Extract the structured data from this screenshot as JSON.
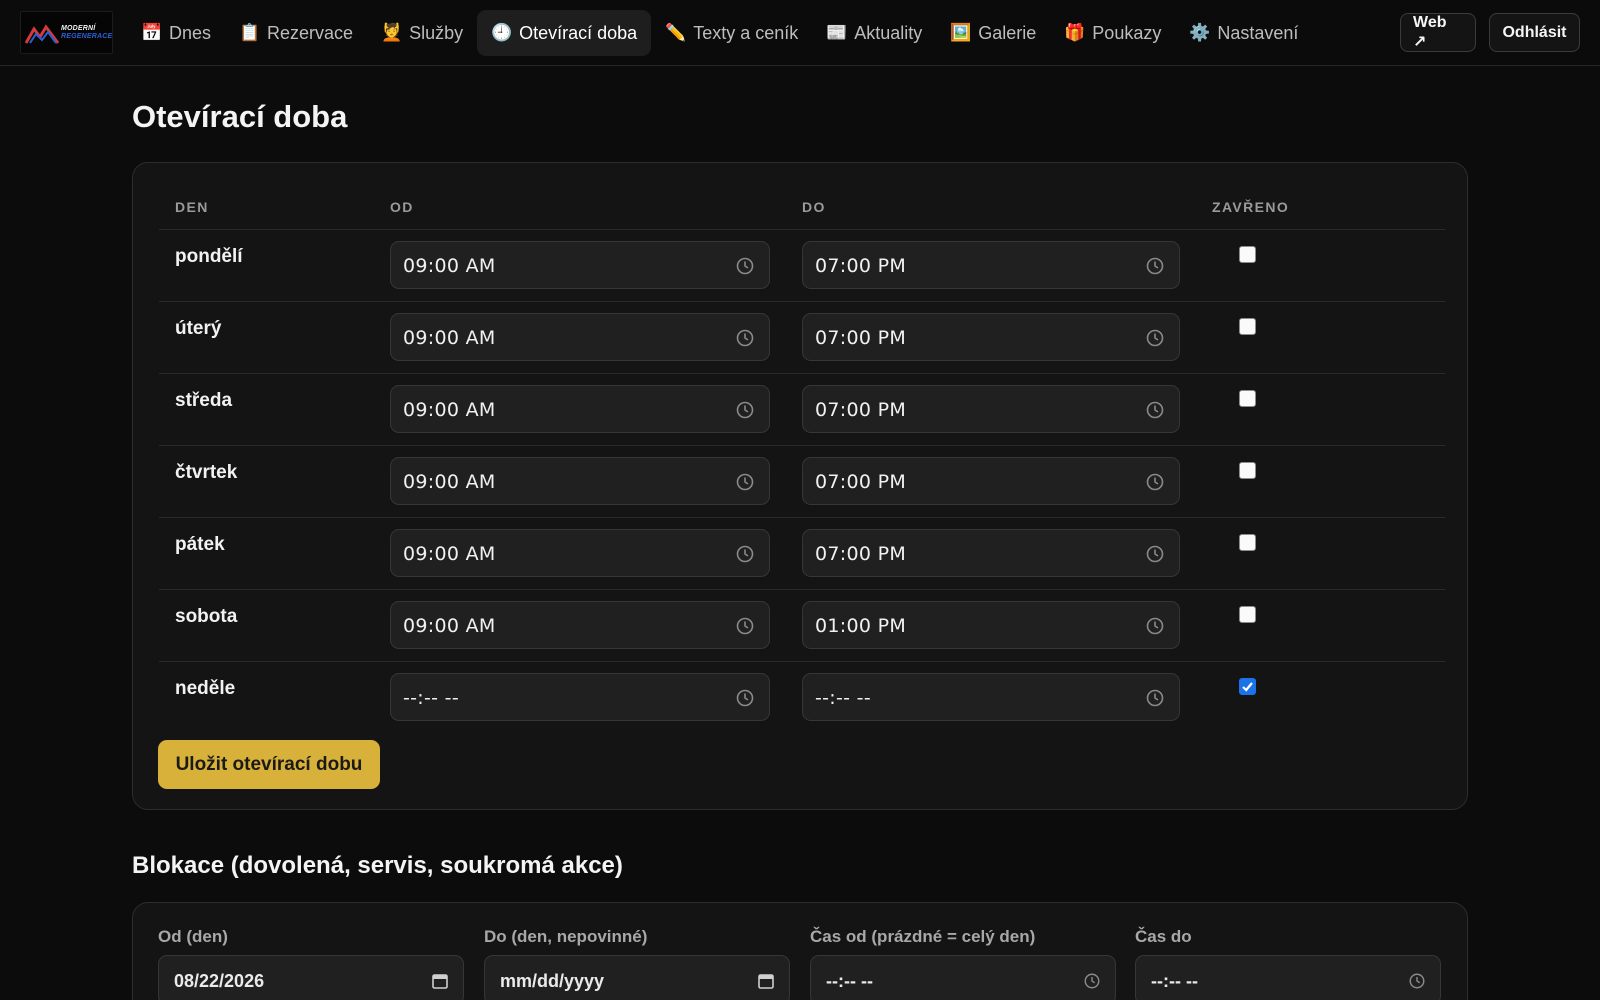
{
  "logo": {
    "line1": "MODERNÍ",
    "line2": "REGENERACE"
  },
  "nav": [
    {
      "icon": "📅",
      "label": "Dnes"
    },
    {
      "icon": "📋",
      "label": "Rezervace"
    },
    {
      "icon": "💆",
      "label": "Služby"
    },
    {
      "icon": "🕘",
      "label": "Otevírací doba",
      "active": true
    },
    {
      "icon": "✏️",
      "label": "Texty a ceník"
    },
    {
      "icon": "📰",
      "label": "Aktuality"
    },
    {
      "icon": "🖼️",
      "label": "Galerie"
    },
    {
      "icon": "🎁",
      "label": "Poukazy"
    },
    {
      "icon": "⚙️",
      "label": "Nastavení"
    }
  ],
  "header_buttons": {
    "web": "Web ↗",
    "logout": "Odhlásit"
  },
  "page_title": "Otevírací doba",
  "table": {
    "headers": {
      "day": "DEN",
      "from": "OD",
      "to": "DO",
      "closed": "ZAVŘENO"
    },
    "rows": [
      {
        "day": "pondělí",
        "from": "09:00 AM",
        "to": "07:00 PM",
        "closed": false
      },
      {
        "day": "úterý",
        "from": "09:00 AM",
        "to": "07:00 PM",
        "closed": false
      },
      {
        "day": "středa",
        "from": "09:00 AM",
        "to": "07:00 PM",
        "closed": false
      },
      {
        "day": "čtvrtek",
        "from": "09:00 AM",
        "to": "07:00 PM",
        "closed": false
      },
      {
        "day": "pátek",
        "from": "09:00 AM",
        "to": "07:00 PM",
        "closed": false
      },
      {
        "day": "sobota",
        "from": "09:00 AM",
        "to": "01:00 PM",
        "closed": false
      },
      {
        "day": "neděle",
        "from": "--:-- --",
        "to": "--:-- --",
        "closed": true
      }
    ]
  },
  "save_button": "Uložit otevírací dobu",
  "blocks": {
    "title": "Blokace (dovolená, servis, soukromá akce)",
    "fields": [
      {
        "label": "Od (den)",
        "value": "08/22/2026",
        "icon": "calendar-icon"
      },
      {
        "label": "Do (den, nepovinné)",
        "value": "mm/dd/yyyy",
        "icon": "calendar-icon"
      },
      {
        "label": "Čas od (prázdné = celý den)",
        "value": "--:-- --",
        "icon": "clock-icon"
      },
      {
        "label": "Čas do",
        "value": "--:-- --",
        "icon": "clock-icon"
      }
    ]
  },
  "colors": {
    "accent": "#d8b13a",
    "background": "#0c0c0c",
    "card": "#141414",
    "checkbox_checked": "#1a73e8"
  }
}
